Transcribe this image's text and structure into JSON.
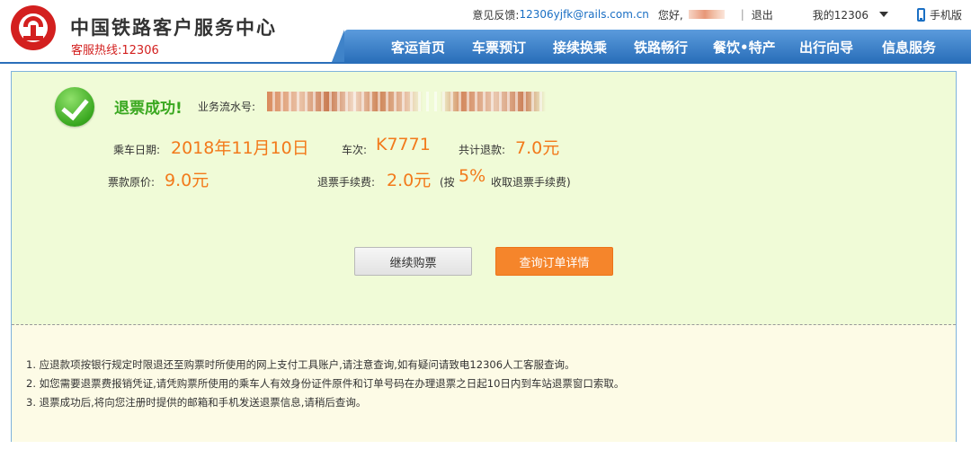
{
  "header": {
    "site_title": "中国铁路客户服务中心",
    "hotline": "客服热线:12306",
    "feedback_label": "意见反馈:",
    "feedback_email": "12306yjfk@rails.com.cn",
    "greeting": "您好,",
    "separator": "|",
    "logout": "退出",
    "my12306": "我的12306",
    "mobile": "手机版"
  },
  "nav": {
    "items": [
      {
        "label": "客运首页"
      },
      {
        "label": "车票预订"
      },
      {
        "label": "接续换乘"
      },
      {
        "label": "铁路畅行"
      },
      {
        "label": "餐饮•特产"
      },
      {
        "label": "出行向导"
      },
      {
        "label": "信息服务"
      }
    ]
  },
  "result": {
    "success_text": "退票成功!",
    "serial_label": "业务流水号:",
    "date_label": "乘车日期:",
    "date_value": "2018年11月10日",
    "train_label": "车次:",
    "train_value": "K7771",
    "total_refund_label": "共计退款:",
    "total_refund_value": "7.0元",
    "original_price_label": "票款原价:",
    "original_price_value": "9.0元",
    "fee_label": "退票手续费:",
    "fee_value": "2.0元",
    "fee_rate_prefix": "(按",
    "fee_rate_value": "5%",
    "fee_rate_suffix": "收取退票手续费)"
  },
  "buttons": {
    "continue": "继续购票",
    "order_detail": "查询订单详情"
  },
  "notes": [
    "1. 应退款项按银行规定时限退还至购票时所使用的网上支付工具账户,请注意查询,如有疑问请致电12306人工客服查询。",
    "2. 如您需要退票费报销凭证,请凭购票所使用的乘车人有效身份证件原件和订单号码在办理退票之日起10日内到车站退票窗口索取。",
    "3. 退票成功后,将向您注册时提供的邮箱和手机发送退票信息,请稍后查询。"
  ],
  "colors": {
    "brand_red": "#d3201f",
    "nav_blue": "#2a6fba",
    "success_green": "#3aa820",
    "value_orange": "#f27a1b",
    "panel_green": "#f0fbd7",
    "notes_bg": "#fdfbe6"
  },
  "icons": {
    "logo": "railway-logo-icon",
    "dropdown": "caret-down-icon",
    "mobile": "phone-icon",
    "status": "success-check-icon"
  }
}
